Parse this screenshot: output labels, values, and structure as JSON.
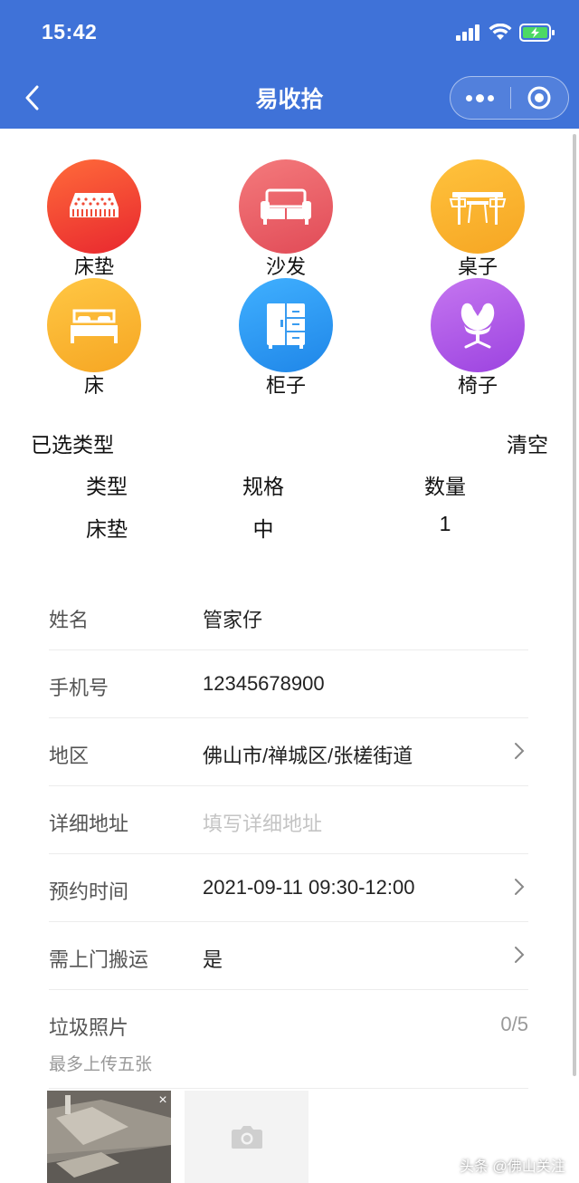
{
  "status_bar": {
    "time": "15:42"
  },
  "nav": {
    "title": "易收拾"
  },
  "categories": [
    {
      "label": "床垫",
      "icon": "mattress-icon",
      "color_from": "#ff5e3a",
      "color_to": "#e8272f"
    },
    {
      "label": "沙发",
      "icon": "sofa-icon",
      "color_from": "#f47a7c",
      "color_to": "#e14b57"
    },
    {
      "label": "桌子",
      "icon": "table-icon",
      "color_from": "#ffc23d",
      "color_to": "#f6a623"
    },
    {
      "label": "床",
      "icon": "bed-icon",
      "color_from": "#ffc744",
      "color_to": "#f6a623"
    },
    {
      "label": "柜子",
      "icon": "cabinet-icon",
      "color_from": "#40b0ff",
      "color_to": "#1f86e8"
    },
    {
      "label": "椅子",
      "icon": "chair-icon",
      "color_from": "#c576f0",
      "color_to": "#9c43e0"
    }
  ],
  "selected": {
    "title": "已选类型",
    "clear_label": "清空",
    "headers": [
      "类型",
      "规格",
      "数量"
    ],
    "rows": [
      [
        "床垫",
        "中",
        "1"
      ]
    ]
  },
  "form": {
    "name": {
      "label": "姓名",
      "value": "管家仔"
    },
    "phone": {
      "label": "手机号",
      "value": "12345678900"
    },
    "region": {
      "label": "地区",
      "value": "佛山市/禅城区/张槎街道"
    },
    "address": {
      "label": "详细地址",
      "placeholder": "填写详细地址"
    },
    "time": {
      "label": "预约时间",
      "value": "2021-09-11 09:30-12:00"
    },
    "carry": {
      "label": "需上门搬运",
      "value": "是"
    }
  },
  "photos": {
    "title": "垃圾照片",
    "count": "0/5",
    "hint": "最多上传五张"
  },
  "watermark": "头条 @佛山关注",
  "colors": {
    "header_bg": "#3f72d8",
    "battery": "#4cd964"
  }
}
